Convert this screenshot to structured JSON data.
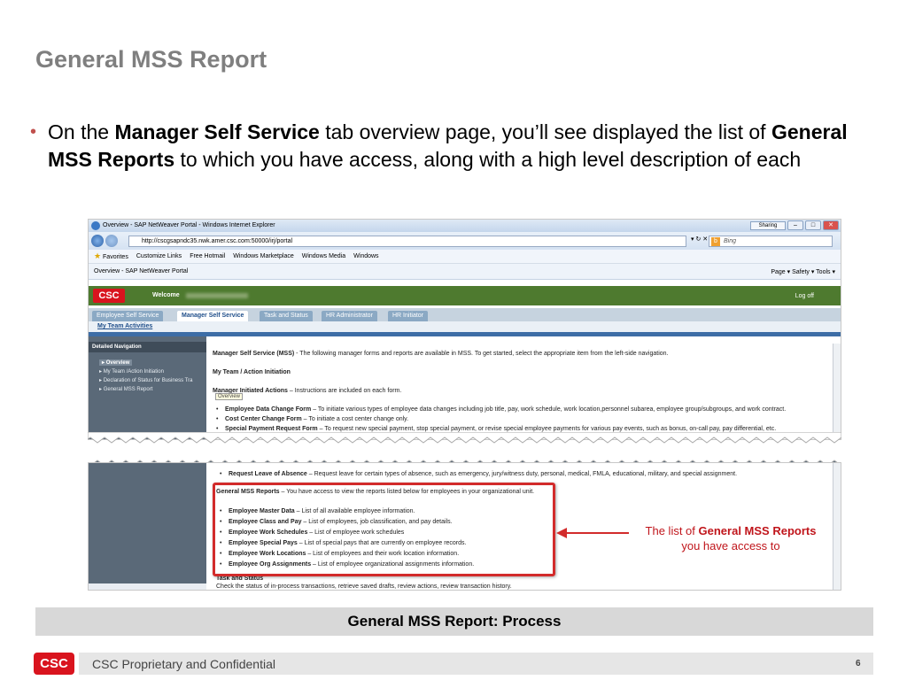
{
  "slide": {
    "title": "General MSS Report",
    "bullet": {
      "prefix": "On the ",
      "bold1": "Manager Self Service",
      "mid1": " tab overview page, you’ll see displayed the list of ",
      "bold2": "General MSS Reports",
      "suffix": " to which you have access, along with a high level description of each"
    },
    "process_bar": "General MSS Report: Process",
    "footer": {
      "confidential": "CSC Proprietary and Confidential",
      "page": "6",
      "logo": "CSC"
    }
  },
  "browser": {
    "window_title": "Overview - SAP NetWeaver Portal - Windows Internet Explorer",
    "sharing": "Sharing",
    "address": "http://cscgsapndc35.nwk.amer.csc.com:50000/irj/portal",
    "search_placeholder": "Bing",
    "favorites": [
      "Favorites",
      "Customize Links",
      "Free Hotmail",
      "Windows Marketplace",
      "Windows Media",
      "Windows"
    ],
    "tab_label": "Overview - SAP NetWeaver Portal",
    "tools": "Page ▾   Safety ▾   Tools ▾"
  },
  "portal": {
    "logo": "CSC",
    "welcome": "Welcome",
    "logoff": "Log off",
    "tabs": [
      "Employee Self Service",
      "Manager Self Service",
      "Task and Status",
      "HR Administrator",
      "HR Initiator"
    ],
    "sub_link": "My Team Activities",
    "nav": {
      "header": "Detailed Navigation",
      "items": [
        "Overview",
        "My Team /Action Initiation",
        "Declaration of Status for Business Tra",
        "General MSS Report"
      ]
    },
    "overview_tip": "Overview",
    "content_top": {
      "intro_bold": "Manager Self Service (MSS)",
      "intro": " - The following manager forms and reports are available in MSS. To get started, select the appropriate item from the left-side navigation.",
      "my_team": "My Team / Action Initiation",
      "mia_bold": "Manager Initiated Actions",
      "mia": " – Instructions are included on each form.",
      "items": [
        {
          "b": "Employee Data Change Form",
          "t": " – To initiate various types of employee data changes including job title, pay, work schedule, work location,personnel subarea, employee group/subgroups, and work contract."
        },
        {
          "b": "Cost Center Change Form",
          "t": " – To initiate a cost center change only."
        },
        {
          "b": "Special Payment Request Form",
          "t": " – To request new special payment, stop special payment, or revise special employee payments for various pay events, such as bonus, on-call pay, pay differential, etc."
        }
      ]
    },
    "content_bottom": {
      "leave_bold": "Request Leave of Absence",
      "leave": " – Request leave for certain types of absence, such as emergency, jury/witness duty, personal, medical, FMLA, educational, military, and special assignment.",
      "gmr_bold": "General MSS Reports",
      "gmr": " – You have access to view the reports listed below for employees in your organizational unit.",
      "items": [
        {
          "b": "Employee Master Data",
          "t": " – List of all available employee information."
        },
        {
          "b": "Employee Class and Pay",
          "t": " – List of employees, job classification, and pay details."
        },
        {
          "b": "Employee Work Schedules",
          "t": " – List of employee work schedules"
        },
        {
          "b": "Employee Special Pays",
          "t": " – List of special pays that are currently on employee records."
        },
        {
          "b": "Employee Work Locations",
          "t": " – List of employees and their work location information."
        },
        {
          "b": "Employee Org Assignments",
          "t": " – List of employee organizational assignments information."
        }
      ],
      "task_status": "Task and Status",
      "task_desc": "Check the status of in-process transactions, retrieve saved drafts, review actions, review transaction history."
    }
  },
  "callout": {
    "prefix": "The list of ",
    "bold": "General MSS Reports",
    "line2": "you have access to"
  }
}
